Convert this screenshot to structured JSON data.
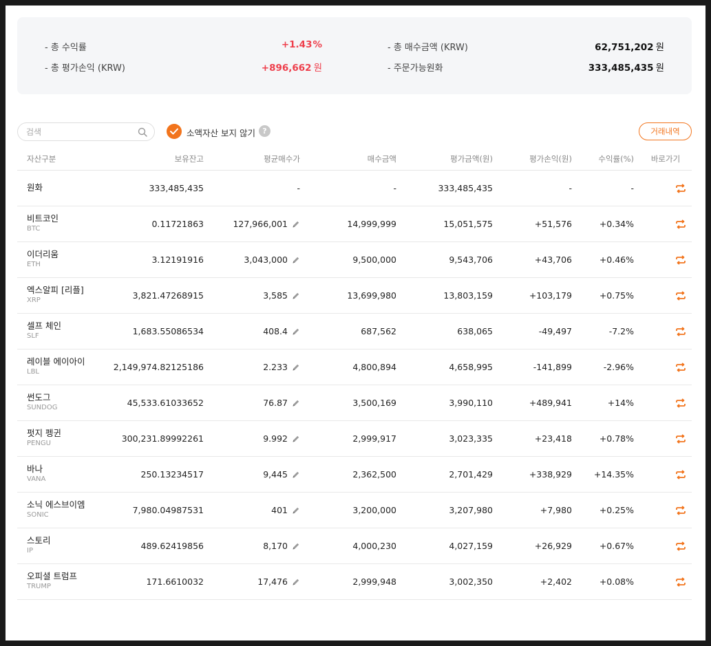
{
  "summary": {
    "total_return_label": "- 총 수익률",
    "total_return_value": "+1.43",
    "total_return_unit": "%",
    "total_pnl_label": "- 총 평가손익 (KRW)",
    "total_pnl_value": "+896,662",
    "total_pnl_unit": "원",
    "total_buy_label": "- 총 매수금액 (KRW)",
    "total_buy_value": "62,751,202",
    "total_buy_unit": "원",
    "orderable_label": "- 주문가능원화",
    "orderable_value": "333,485,435",
    "orderable_unit": "원"
  },
  "toolbar": {
    "search_placeholder": "검색",
    "hide_small_label": "소액자산 보지 않기",
    "help_glyph": "?",
    "history_button": "거래내역"
  },
  "columns": [
    "자산구분",
    "보유잔고",
    "평균매수가",
    "매수금액",
    "평가금액(원)",
    "평가손익(원)",
    "수익률(%)",
    "바로가기"
  ],
  "rows": [
    {
      "name": "원화",
      "symbol": "",
      "balance": "333,485,435",
      "avg_price": "-",
      "buy_amount": "-",
      "eval_amount": "333,485,435",
      "pnl": "-",
      "rate": "-",
      "sign": "none",
      "editable": false
    },
    {
      "name": "비트코인",
      "symbol": "BTC",
      "balance": "0.11721863",
      "avg_price": "127,966,001",
      "buy_amount": "14,999,999",
      "eval_amount": "15,051,575",
      "pnl": "+51,576",
      "rate": "+0.34%",
      "sign": "up",
      "editable": true
    },
    {
      "name": "이더리움",
      "symbol": "ETH",
      "balance": "3.12191916",
      "avg_price": "3,043,000",
      "buy_amount": "9,500,000",
      "eval_amount": "9,543,706",
      "pnl": "+43,706",
      "rate": "+0.46%",
      "sign": "up",
      "editable": true
    },
    {
      "name": "엑스알피 [리플]",
      "symbol": "XRP",
      "balance": "3,821.47268915",
      "avg_price": "3,585",
      "buy_amount": "13,699,980",
      "eval_amount": "13,803,159",
      "pnl": "+103,179",
      "rate": "+0.75%",
      "sign": "up",
      "editable": true
    },
    {
      "name": "셀프 체인",
      "symbol": "SLF",
      "balance": "1,683.55086534",
      "avg_price": "408.4",
      "buy_amount": "687,562",
      "eval_amount": "638,065",
      "pnl": "-49,497",
      "rate": "-7.2%",
      "sign": "down",
      "editable": true
    },
    {
      "name": "레이블 에이아이",
      "symbol": "LBL",
      "balance": "2,149,974.82125186",
      "avg_price": "2.233",
      "buy_amount": "4,800,894",
      "eval_amount": "4,658,995",
      "pnl": "-141,899",
      "rate": "-2.96%",
      "sign": "down",
      "editable": true
    },
    {
      "name": "썬도그",
      "symbol": "SUNDOG",
      "balance": "45,533.61033652",
      "avg_price": "76.87",
      "buy_amount": "3,500,169",
      "eval_amount": "3,990,110",
      "pnl": "+489,941",
      "rate": "+14%",
      "sign": "up",
      "editable": true
    },
    {
      "name": "펏지 펭귄",
      "symbol": "PENGU",
      "balance": "300,231.89992261",
      "avg_price": "9.992",
      "buy_amount": "2,999,917",
      "eval_amount": "3,023,335",
      "pnl": "+23,418",
      "rate": "+0.78%",
      "sign": "up",
      "editable": true
    },
    {
      "name": "바나",
      "symbol": "VANA",
      "balance": "250.13234517",
      "avg_price": "9,445",
      "buy_amount": "2,362,500",
      "eval_amount": "2,701,429",
      "pnl": "+338,929",
      "rate": "+14.35%",
      "sign": "up",
      "editable": true
    },
    {
      "name": "소닉 에스브이엠",
      "symbol": "SONIC",
      "balance": "7,980.04987531",
      "avg_price": "401",
      "buy_amount": "3,200,000",
      "eval_amount": "3,207,980",
      "pnl": "+7,980",
      "rate": "+0.25%",
      "sign": "up",
      "editable": true
    },
    {
      "name": "스토리",
      "symbol": "IP",
      "balance": "489.62419856",
      "avg_price": "8,170",
      "buy_amount": "4,000,230",
      "eval_amount": "4,027,159",
      "pnl": "+26,929",
      "rate": "+0.67%",
      "sign": "up",
      "editable": true
    },
    {
      "name": "오피셜 트럼프",
      "symbol": "TRUMP",
      "balance": "171.6610032",
      "avg_price": "17,476",
      "buy_amount": "2,999,948",
      "eval_amount": "3,002,350",
      "pnl": "+2,402",
      "rate": "+0.08%",
      "sign": "up",
      "editable": true
    }
  ],
  "colors": {
    "up": "#ee3f4c",
    "down": "#3d7fe0",
    "accent": "#f2741c"
  },
  "icons": {
    "search": "search-icon",
    "check": "check-icon",
    "edit": "pencil-icon",
    "shortcut": "exchange-icon"
  }
}
